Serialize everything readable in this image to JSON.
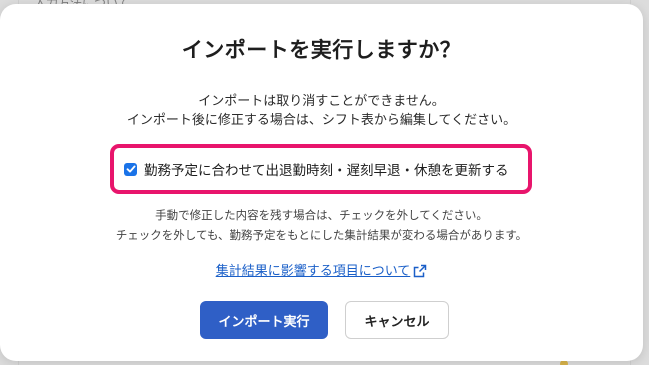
{
  "background": {
    "top_text": "入力方法について",
    "edge_chars": [
      "2",
      "2",
      "カ"
    ]
  },
  "dialog": {
    "title": "インポートを実行しますか？",
    "description": [
      "インポートは取り消すことができません。",
      "インポート後に修正する場合は、シフト表から編集してください。"
    ],
    "checkbox": {
      "checked": true,
      "label": "勤務予定に合わせて出退勤時刻・遅刻早退・休憩を更新する"
    },
    "note": [
      "手動で修正した内容を残す場合は、チェックを外してください。",
      "チェックを外しても、勤務予定をもとにした集計結果が変わる場合があります。"
    ],
    "help_link": {
      "label": "集計結果に影響する項目について",
      "icon": "external-link-icon"
    },
    "buttons": {
      "primary": "インポート実行",
      "secondary": "キャンセル"
    }
  },
  "colors": {
    "highlight_border": "#e8156c",
    "primary_button": "#2f5fc6",
    "link": "#1a5fc8",
    "checkbox": "#1a73e8"
  }
}
